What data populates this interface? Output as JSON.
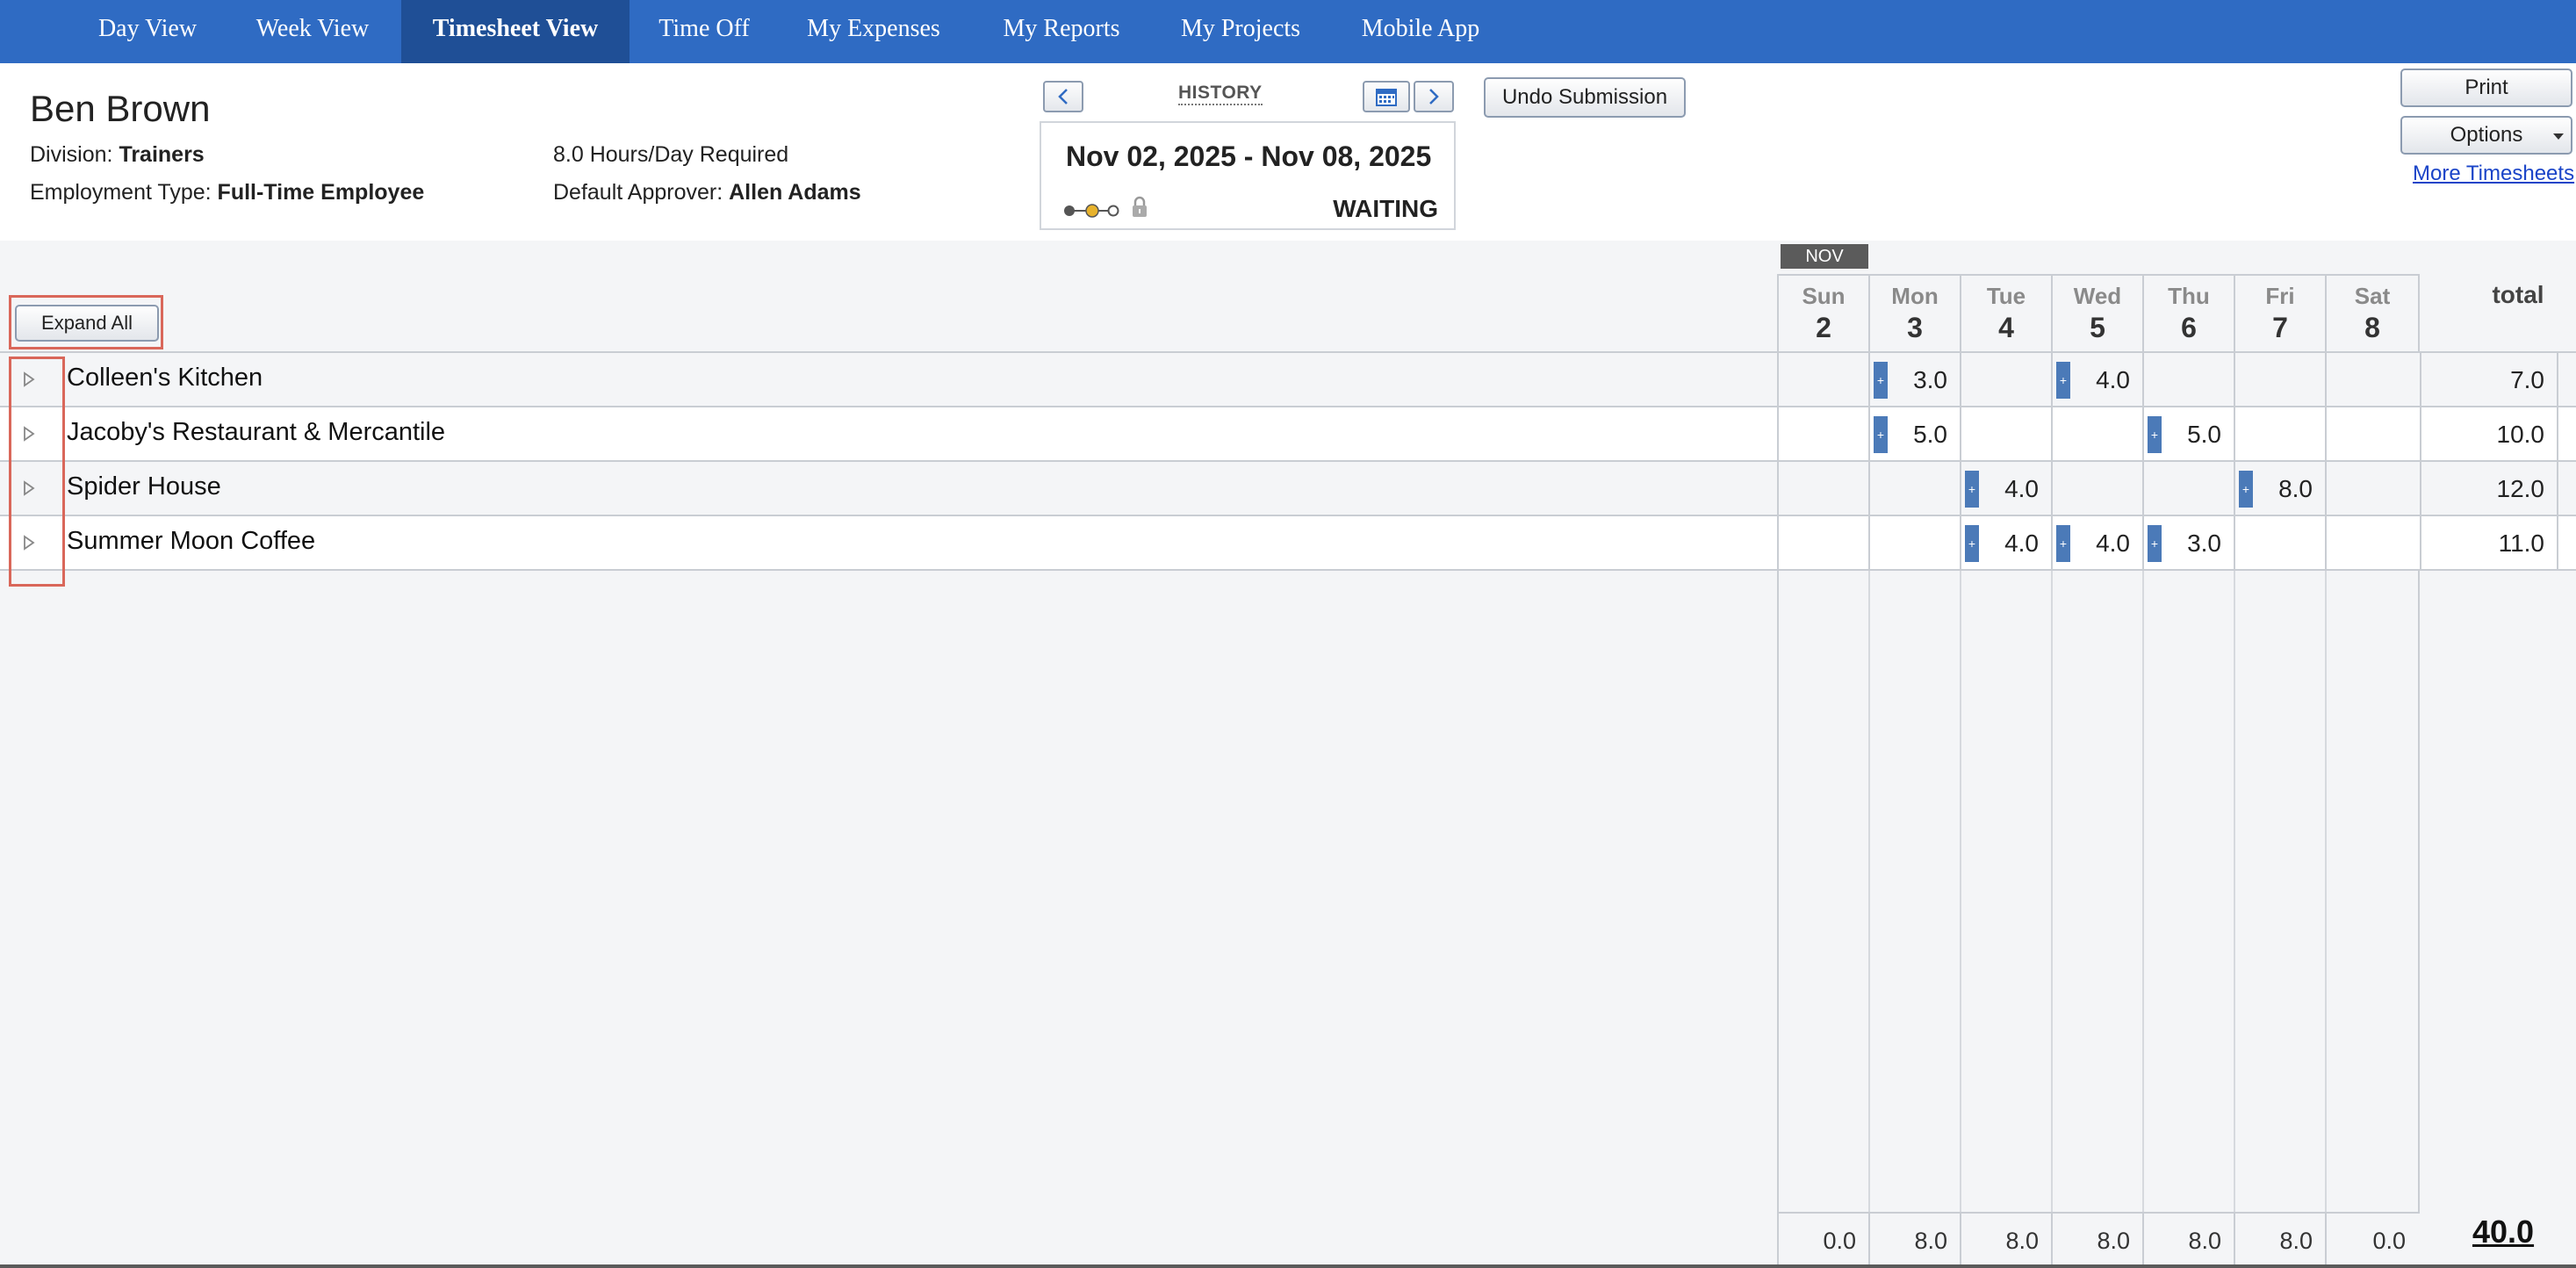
{
  "nav": {
    "items": [
      {
        "label": "Day View",
        "active": false
      },
      {
        "label": "Week View",
        "active": false
      },
      {
        "label": "Timesheet View",
        "active": true
      },
      {
        "label": "Time Off",
        "active": false
      },
      {
        "label": "My Expenses",
        "active": false
      },
      {
        "label": "My Reports",
        "active": false
      },
      {
        "label": "My Projects",
        "active": false
      },
      {
        "label": "Mobile App",
        "active": false
      }
    ]
  },
  "employee": {
    "name": "Ben Brown",
    "division_label": "Division:",
    "division": "Trainers",
    "employment_label": "Employment Type:",
    "employment": "Full-Time Employee",
    "hours_required": "8.0 Hours/Day Required",
    "approver_label": "Default Approver:",
    "approver": "Allen Adams"
  },
  "period": {
    "history_label": "HISTORY",
    "range": "Nov 02, 2025 - Nov 08, 2025",
    "status": "WAITING",
    "prev_icon": "chevron-left-icon",
    "next_icon": "chevron-right-icon",
    "calendar_icon": "calendar-icon"
  },
  "buttons": {
    "undo": "Undo Submission",
    "print": "Print",
    "options": "Options",
    "more_timesheets": "More Timesheets",
    "expand_all": "Expand All"
  },
  "grid": {
    "month": "NOV",
    "total_label": "total",
    "days": [
      {
        "name": "Sun",
        "num": "2"
      },
      {
        "name": "Mon",
        "num": "3"
      },
      {
        "name": "Tue",
        "num": "4"
      },
      {
        "name": "Wed",
        "num": "5"
      },
      {
        "name": "Thu",
        "num": "6"
      },
      {
        "name": "Fri",
        "num": "7"
      },
      {
        "name": "Sat",
        "num": "8"
      }
    ],
    "rows": [
      {
        "name": "Colleen's Kitchen",
        "hours": [
          "",
          "3.0",
          "",
          "4.0",
          "",
          "",
          ""
        ],
        "total": "7.0"
      },
      {
        "name": "Jacoby's Restaurant & Mercantile",
        "hours": [
          "",
          "5.0",
          "",
          "",
          "5.0",
          "",
          ""
        ],
        "total": "10.0"
      },
      {
        "name": "Spider House",
        "hours": [
          "",
          "",
          "4.0",
          "",
          "",
          "8.0",
          ""
        ],
        "total": "12.0"
      },
      {
        "name": "Summer Moon Coffee",
        "hours": [
          "",
          "",
          "4.0",
          "4.0",
          "3.0",
          "",
          ""
        ],
        "total": "11.0"
      }
    ],
    "day_totals": [
      "0.0",
      "8.0",
      "8.0",
      "8.0",
      "8.0",
      "8.0",
      "0.0"
    ],
    "grand_total": "40.0"
  },
  "colors": {
    "nav_bg": "#2f6bc3",
    "nav_active": "#1f4f96",
    "marker": "#4b7ab8",
    "highlight": "#d9675a",
    "progress_current": "#e7b22c"
  }
}
